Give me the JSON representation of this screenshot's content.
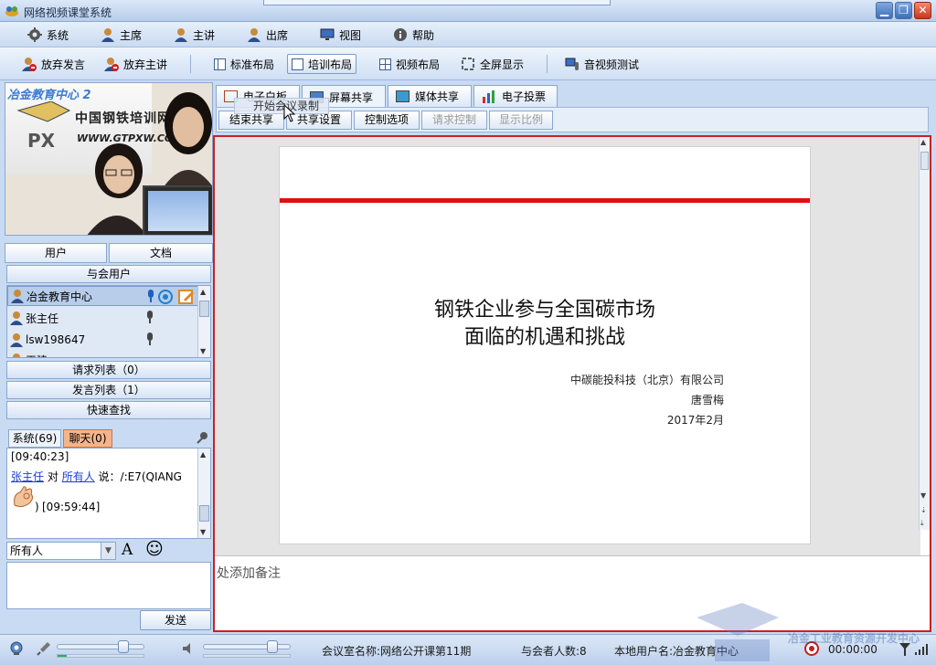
{
  "window": {
    "title": "网络视频课堂系统",
    "buttons": {
      "minimize": "▁",
      "restore": "❐",
      "close": "✕"
    }
  },
  "menu": {
    "items": [
      {
        "label": "系统",
        "icon": "gear-icon"
      },
      {
        "label": "主席",
        "icon": "user-icon"
      },
      {
        "label": "主讲",
        "icon": "user-icon"
      },
      {
        "label": "出席",
        "icon": "user-icon"
      },
      {
        "label": "视图",
        "icon": "monitor-icon"
      },
      {
        "label": "帮助",
        "icon": "info-icon"
      }
    ]
  },
  "toolbar": {
    "give_up_speak": "放弃发言",
    "give_up_lecturer": "放弃主讲",
    "standard_layout": "标准布局",
    "training_layout": "培训布局",
    "video_layout": "视频布局",
    "fullscreen": "全屏显示",
    "av_test": "音视频测试",
    "active": "培训布局"
  },
  "video": {
    "sign_title": "冶金教育中心 2",
    "sign_cn": "中国钢铁培训网",
    "sign_url": "WWW.GTPXW.COM",
    "logo_letters": "PX"
  },
  "left_tabs": {
    "users": "用户",
    "docs": "文档"
  },
  "attendees_header": "与会用户",
  "users": [
    {
      "name": "冶金教育中心",
      "selected": true
    },
    {
      "name": "张主任",
      "selected": false
    },
    {
      "name": "lsw198647",
      "selected": false
    },
    {
      "name": "王建",
      "selected": false
    }
  ],
  "lists": {
    "request": "请求列表（0）",
    "speak": "发言列表（1）",
    "quick_find": "快速查找"
  },
  "chat": {
    "tab_system": "系统(69)",
    "tab_chat": "聊天(0)",
    "time1": "[09:40:23]",
    "sender": "张主任",
    "to_word": "对",
    "recipient": "所有人",
    "says": "说：/:E7(QIANG",
    "emoji_tail": ")",
    "time2": "[09:59:44]",
    "target_select": "所有人",
    "font_btn": "A",
    "emoji_btn": "☺",
    "send": "发送"
  },
  "main_tabs": {
    "whiteboard": "电子白板",
    "screen_share": "屏幕共享",
    "media_share": "媒体共享",
    "vote": "电子投票",
    "active": "屏幕共享"
  },
  "sub_buttons": {
    "end_share": "结束共享",
    "share_settings": "共享设置",
    "control_options": "控制选项",
    "request_control": "请求控制",
    "display_ratio": "显示比例"
  },
  "tooltip": "开始会议录制",
  "slide": {
    "title_line1": "钢铁企业参与全国碳市场",
    "title_line2": "面临的机遇和挑战",
    "company": "中碳能投科技（北京）有限公司",
    "author": "唐雪梅",
    "date": "2017年2月"
  },
  "notes": {
    "placeholder": "处添加备注"
  },
  "status": {
    "room": "会议室名称:网络公开课第11期",
    "count": "与会者人数:8",
    "local_user": "本地用户名:冶金教育中心",
    "timer": "00:00:00",
    "mic_volume": 0.78,
    "speaker_volume": 0.82,
    "mic_level": 0.1
  },
  "watermark": {
    "text": "冶金工业教育资源开发中心"
  },
  "colors": {
    "accent_red": "#cc2020",
    "chat_tab_active": "#f5b48a",
    "link": "#1a3fd0"
  }
}
